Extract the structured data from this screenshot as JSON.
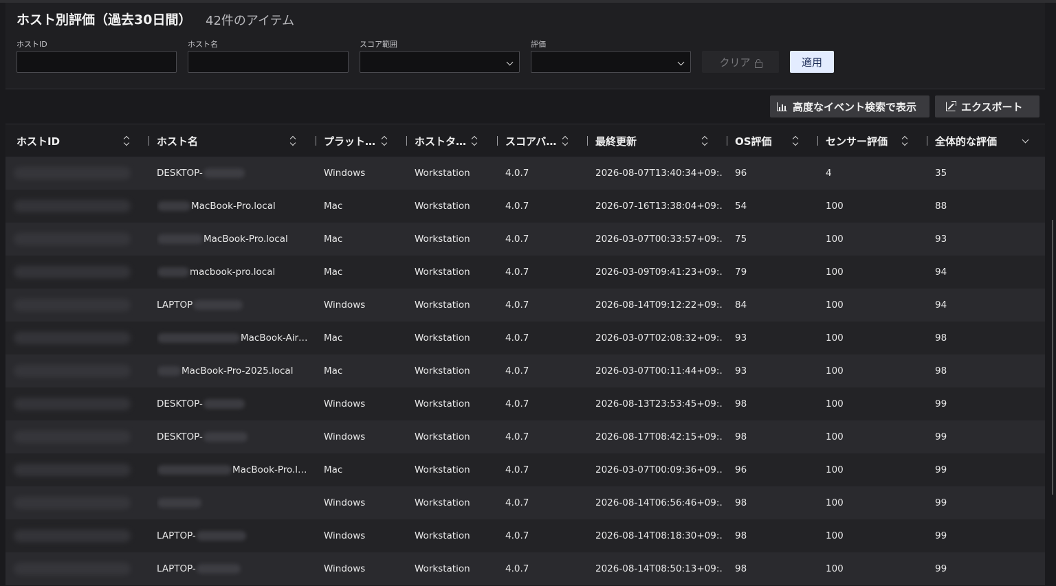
{
  "header": {
    "title": "ホスト別評価（過去30日間）",
    "count": "42件のアイテム"
  },
  "filters": {
    "host_id_label": "ホストID",
    "host_name_label": "ホスト名",
    "score_range_label": "スコア範囲",
    "rating_label": "評価",
    "clear_label": "クリア",
    "apply_label": "適用"
  },
  "toolbar": {
    "advanced_search_label": "高度なイベント検索で表示",
    "export_label": "エクスポート"
  },
  "columns": [
    "ホストID",
    "ホスト名",
    "プラット…",
    "ホストタ…",
    "スコアバ…",
    "最終更新",
    "OS評価",
    "センサー評価",
    "全体的な評価"
  ],
  "rows": [
    {
      "host_prefix": "DESKTOP-",
      "host_suffix": "",
      "blur_w": 60,
      "platform": "Windows",
      "type": "Workstation",
      "version": "4.0.7",
      "updated": "2026-08-07T13:40:34+09:…",
      "os": "96",
      "sensor": "4",
      "overall": "35"
    },
    {
      "host_prefix": "",
      "host_suffix": "MacBook-Pro.local",
      "blur_w": 48,
      "platform": "Mac",
      "type": "Workstation",
      "version": "4.0.7",
      "updated": "2026-07-16T13:38:04+09:…",
      "os": "54",
      "sensor": "100",
      "overall": "88"
    },
    {
      "host_prefix": "",
      "host_suffix": "MacBook-Pro.local",
      "blur_w": 66,
      "platform": "Mac",
      "type": "Workstation",
      "version": "4.0.7",
      "updated": "2026-03-07T00:33:57+09:…",
      "os": "75",
      "sensor": "100",
      "overall": "93"
    },
    {
      "host_prefix": "",
      "host_suffix": "macbook-pro.local",
      "blur_w": 46,
      "platform": "Mac",
      "type": "Workstation",
      "version": "4.0.7",
      "updated": "2026-03-09T09:41:23+09:…",
      "os": "79",
      "sensor": "100",
      "overall": "94"
    },
    {
      "host_prefix": "LAPTOP",
      "host_suffix": "",
      "blur_w": 72,
      "platform": "Windows",
      "type": "Workstation",
      "version": "4.0.7",
      "updated": "2026-08-14T09:12:22+09:…",
      "os": "84",
      "sensor": "100",
      "overall": "94"
    },
    {
      "host_prefix": "",
      "host_suffix": "MacBook-Air…",
      "blur_w": 120,
      "platform": "Mac",
      "type": "Workstation",
      "version": "4.0.7",
      "updated": "2026-03-07T02:08:32+09:…",
      "os": "93",
      "sensor": "100",
      "overall": "98"
    },
    {
      "host_prefix": "",
      "host_suffix": "MacBook-Pro-2025.local",
      "blur_w": 34,
      "platform": "Mac",
      "type": "Workstation",
      "version": "4.0.7",
      "updated": "2026-03-07T00:11:44+09:…",
      "os": "93",
      "sensor": "100",
      "overall": "98"
    },
    {
      "host_prefix": "DESKTOP-",
      "host_suffix": "",
      "blur_w": 60,
      "platform": "Windows",
      "type": "Workstation",
      "version": "4.0.7",
      "updated": "2026-08-13T23:53:45+09:…",
      "os": "98",
      "sensor": "100",
      "overall": "99"
    },
    {
      "host_prefix": "DESKTOP-",
      "host_suffix": "",
      "blur_w": 64,
      "platform": "Windows",
      "type": "Workstation",
      "version": "4.0.7",
      "updated": "2026-08-17T08:42:15+09:…",
      "os": "98",
      "sensor": "100",
      "overall": "99"
    },
    {
      "host_prefix": "",
      "host_suffix": "MacBook-Pro.l…",
      "blur_w": 108,
      "platform": "Mac",
      "type": "Workstation",
      "version": "4.0.7",
      "updated": "2026-03-07T00:09:36+09…",
      "os": "96",
      "sensor": "100",
      "overall": "99"
    },
    {
      "host_prefix": "",
      "host_suffix": "",
      "blur_w": 64,
      "platform": "Windows",
      "type": "Workstation",
      "version": "4.0.7",
      "updated": "2026-08-14T06:56:46+09:…",
      "os": "98",
      "sensor": "100",
      "overall": "99"
    },
    {
      "host_prefix": "LAPTOP-",
      "host_suffix": "",
      "blur_w": 72,
      "platform": "Windows",
      "type": "Workstation",
      "version": "4.0.7",
      "updated": "2026-08-14T08:18:30+09:…",
      "os": "98",
      "sensor": "100",
      "overall": "99"
    },
    {
      "host_prefix": "LAPTOP-",
      "host_suffix": "",
      "blur_w": 64,
      "platform": "Windows",
      "type": "Workstation",
      "version": "4.0.7",
      "updated": "2026-08-14T08:50:13+09:…",
      "os": "98",
      "sensor": "100",
      "overall": "99"
    }
  ]
}
